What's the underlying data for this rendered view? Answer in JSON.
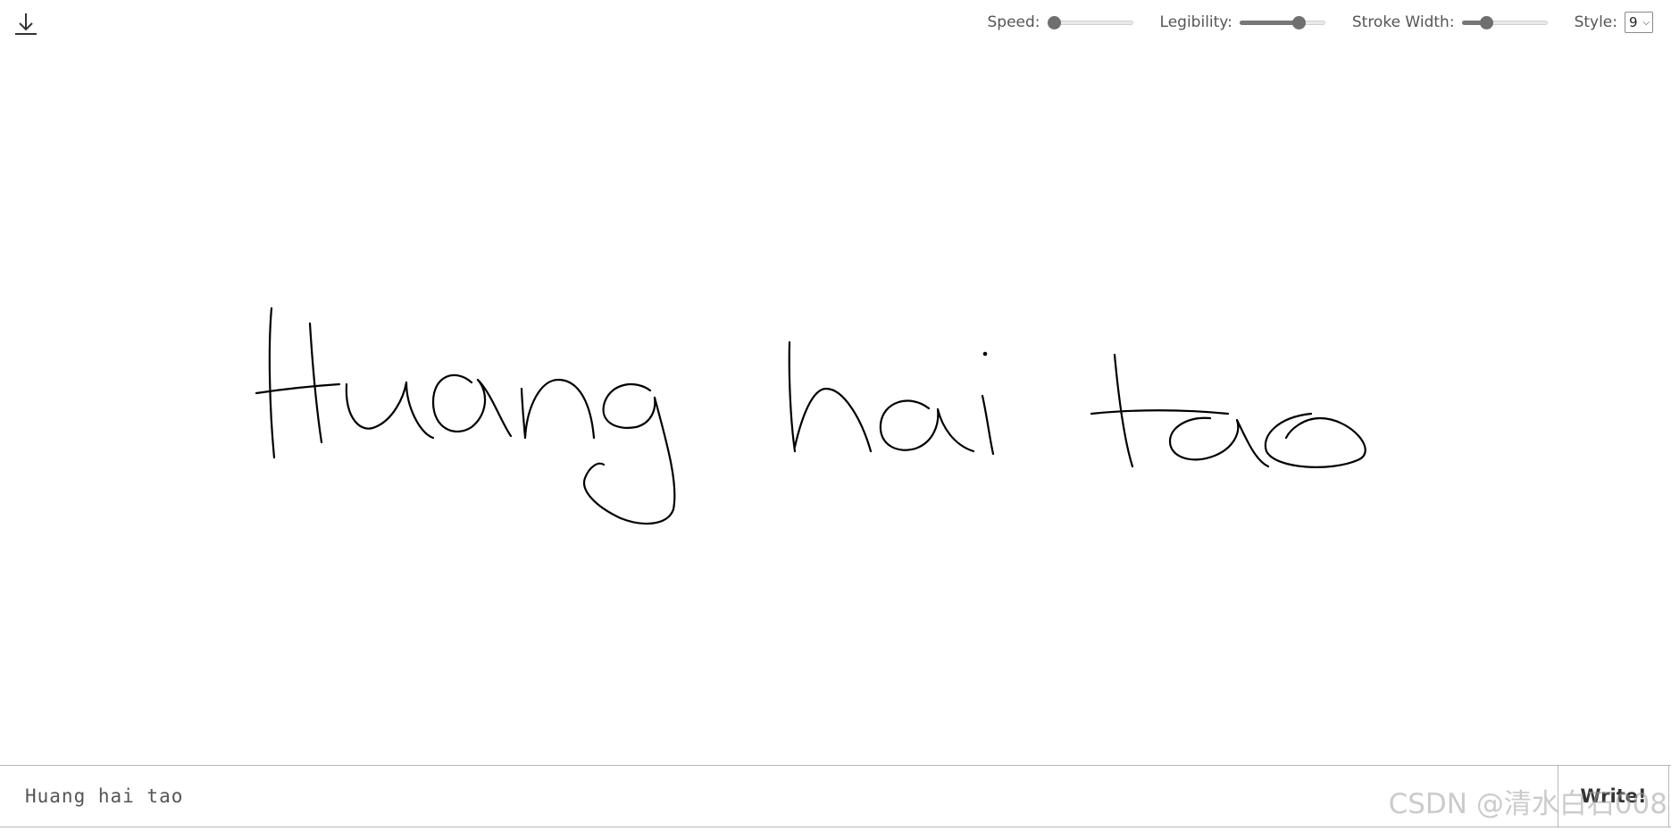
{
  "toolbar": {
    "download_icon": "download-icon",
    "speed": {
      "label": "Speed:",
      "value": 0.0
    },
    "legibility": {
      "label": "Legibility:",
      "value": 0.72
    },
    "stroke_width": {
      "label": "Stroke Width:",
      "value": 0.25
    },
    "style": {
      "label": "Style:",
      "value": "9"
    }
  },
  "canvas": {
    "handwriting_text": "Huang hai tao",
    "stroke_color": "#000000"
  },
  "input": {
    "value": "Huang hai tao"
  },
  "write_button": {
    "label": "Write!"
  },
  "watermark": {
    "text": "CSDN @清水白石008"
  },
  "colors": {
    "background": "#ffffff",
    "slider_thumb": "#6f6f6f",
    "slider_fill": "#777777",
    "border": "#b8b8b8"
  }
}
